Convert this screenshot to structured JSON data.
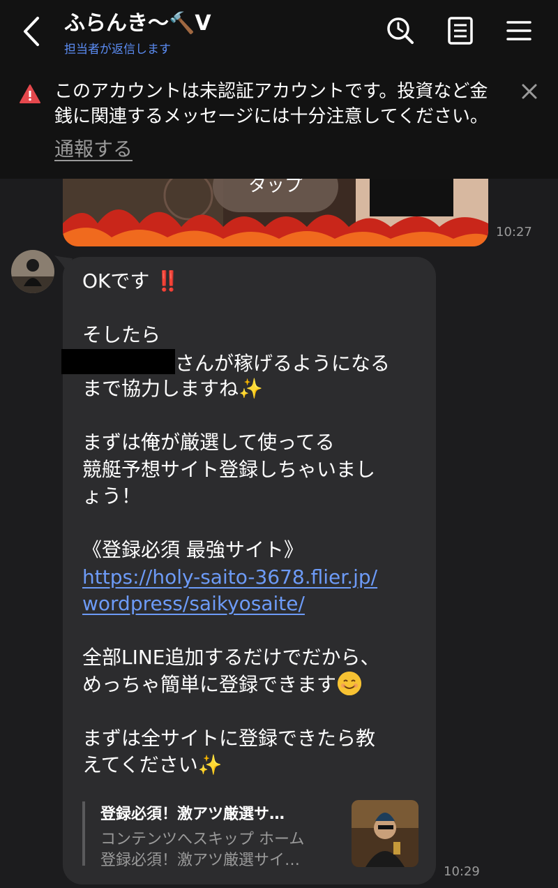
{
  "header": {
    "title": "ふらんき〜🔨V",
    "subtitle": "担当者が返信します",
    "icons": [
      "back-chevron-icon",
      "search-clock-icon",
      "notes-icon",
      "menu-icon"
    ]
  },
  "warning": {
    "text_line1": "このアカウントは未認証アカウントです。投資など金",
    "text_line2": "銭に関連するメッセージには十分注意してください。",
    "report_label": "通報する"
  },
  "prev_message": {
    "image_caption": "タップ",
    "time": "10:27"
  },
  "message": {
    "lines": [
      "OKです",
      "",
      "そしたら",
      "さんが稼げるようになる",
      "まで協力しますね✨",
      "",
      "まずは俺が厳選して使ってる",
      "競艇予想サイト登録しちゃいまし",
      "ょう！",
      "",
      "《登録必須 最強サイト》",
      "https://holy-saito-3678.flier.jp/",
      "wordpress/saikyosaite/",
      "",
      "全部LINE追加するだけでだから、",
      "めっちゃ簡単に登録できます",
      "",
      "まずは全サイトに登録できたら教",
      "えてください✨"
    ],
    "exclamation": "‼️",
    "time": "10:29"
  },
  "link_preview": {
    "title": "登録必須！激アツ厳選サ…",
    "site": "コンテンツへスキップ ホーム",
    "description": "登録必須！激アツ厳選サイ…"
  },
  "colors": {
    "background": "#1c1c1e",
    "header_bg": "#121212",
    "bubble": "#2c2c2e",
    "link": "#6d9bf7",
    "subtitle": "#5b8cf3",
    "warning_red": "#e5484d"
  }
}
